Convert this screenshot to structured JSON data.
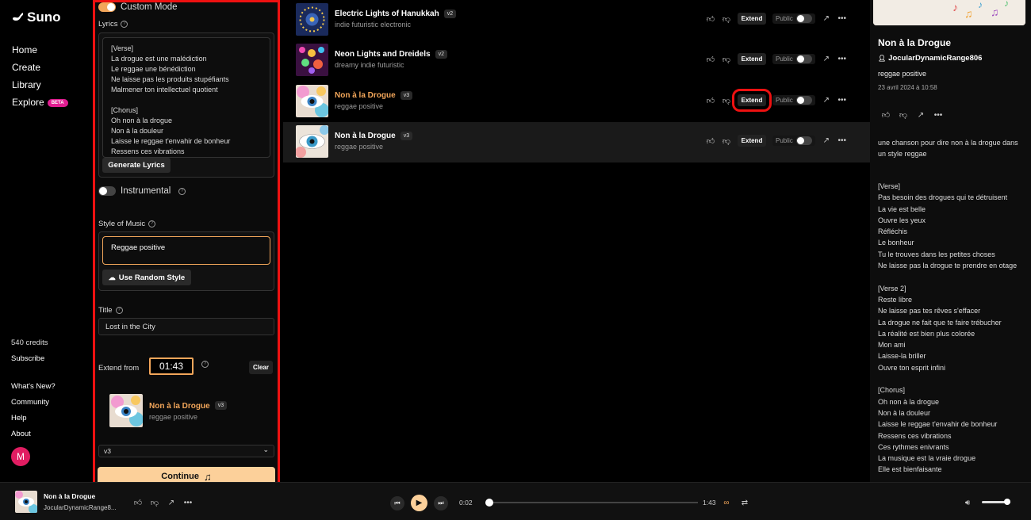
{
  "nav": {
    "brand": "Suno",
    "items": [
      "Home",
      "Create",
      "Library",
      "Explore"
    ],
    "beta": "BETA",
    "credits": "540 credits",
    "subscribe": "Subscribe",
    "footer": [
      "What's New?",
      "Community",
      "Help",
      "About"
    ],
    "avatar": "M"
  },
  "create": {
    "custom_mode": "Custom Mode",
    "lyrics_label": "Lyrics",
    "lyrics_text": "[Verse]\nLa drogue est une malédiction\nLe reggae une bénédiction\nNe laisse pas les produits stupéfiants\nMalmener ton intellectuel quotient\n\n[Chorus]\nOh non à la drogue\nNon à la douleur\nLaisse le reggae t'envahir de bonheur\nRessens ces vibrations",
    "generate_lyrics": "Generate Lyrics",
    "instrumental": "Instrumental",
    "style_label": "Style of Music",
    "style_value": "Reggae positive",
    "random_style": "Use Random Style",
    "title_label": "Title",
    "title_value": "Lost in the City",
    "extend_from": "Extend from",
    "extend_time": "01:43",
    "clear": "Clear",
    "mini_song_title": "Non à la Drogue",
    "mini_song_version": "v3",
    "mini_song_style": "reggae positive",
    "model": "v3",
    "continue": "Continue"
  },
  "songs": [
    {
      "title": "Electric Lights of Hanukkah",
      "version": "v2",
      "style": "indie futuristic electronic",
      "extend": "Extend",
      "public": "Public"
    },
    {
      "title": "Neon Lights and Dreidels",
      "version": "v2",
      "style": "dreamy indie futuristic",
      "extend": "Extend",
      "public": "Public"
    },
    {
      "title": "Non à la Drogue",
      "version": "v3",
      "style": "reggae positive",
      "extend": "Extend",
      "public": "Public"
    },
    {
      "title": "Non à la Drogue",
      "version": "v3",
      "style": "reggae positive",
      "extend": "Extend",
      "public": "Public"
    }
  ],
  "detail": {
    "title": "Non à la Drogue",
    "user": "JocularDynamicRange806",
    "style": "reggae positive",
    "date": "23 avril 2024 à 10:58",
    "description": "une chanson pour dire non à la drogue dans un style reggae",
    "lyrics": "[Verse]\nPas besoin des drogues qui te détruisent\nLa vie est belle\nOuvre les yeux\nRéfléchis\nLe bonheur\nTu le trouves dans les petites choses\nNe laisse pas la drogue te prendre en otage\n\n[Verse 2]\nReste libre\nNe laisse pas tes rêves s'effacer\nLa drogue ne fait que te faire trébucher\nLa réalité est bien plus colorée\nMon ami\nLaisse-la briller\nOuvre ton esprit infini\n\n[Chorus]\nOh non à la drogue\nNon à la douleur\nLaisse le reggae t'envahir de bonheur\nRessens ces vibrations\nCes rythmes enivrants\nLa musique est la vraie drogue\nElle est bienfaisante"
  },
  "player": {
    "title": "Non à la Drogue",
    "user": "JocularDynamicRange8...",
    "elapsed": "0:02",
    "duration": "1:43",
    "progress": 0.02,
    "volume": 0.9
  },
  "colors": {
    "accent": "#f2a65a",
    "highlight": "#ee1111",
    "continue": "#fcd09a",
    "beta": "#e11d91"
  }
}
